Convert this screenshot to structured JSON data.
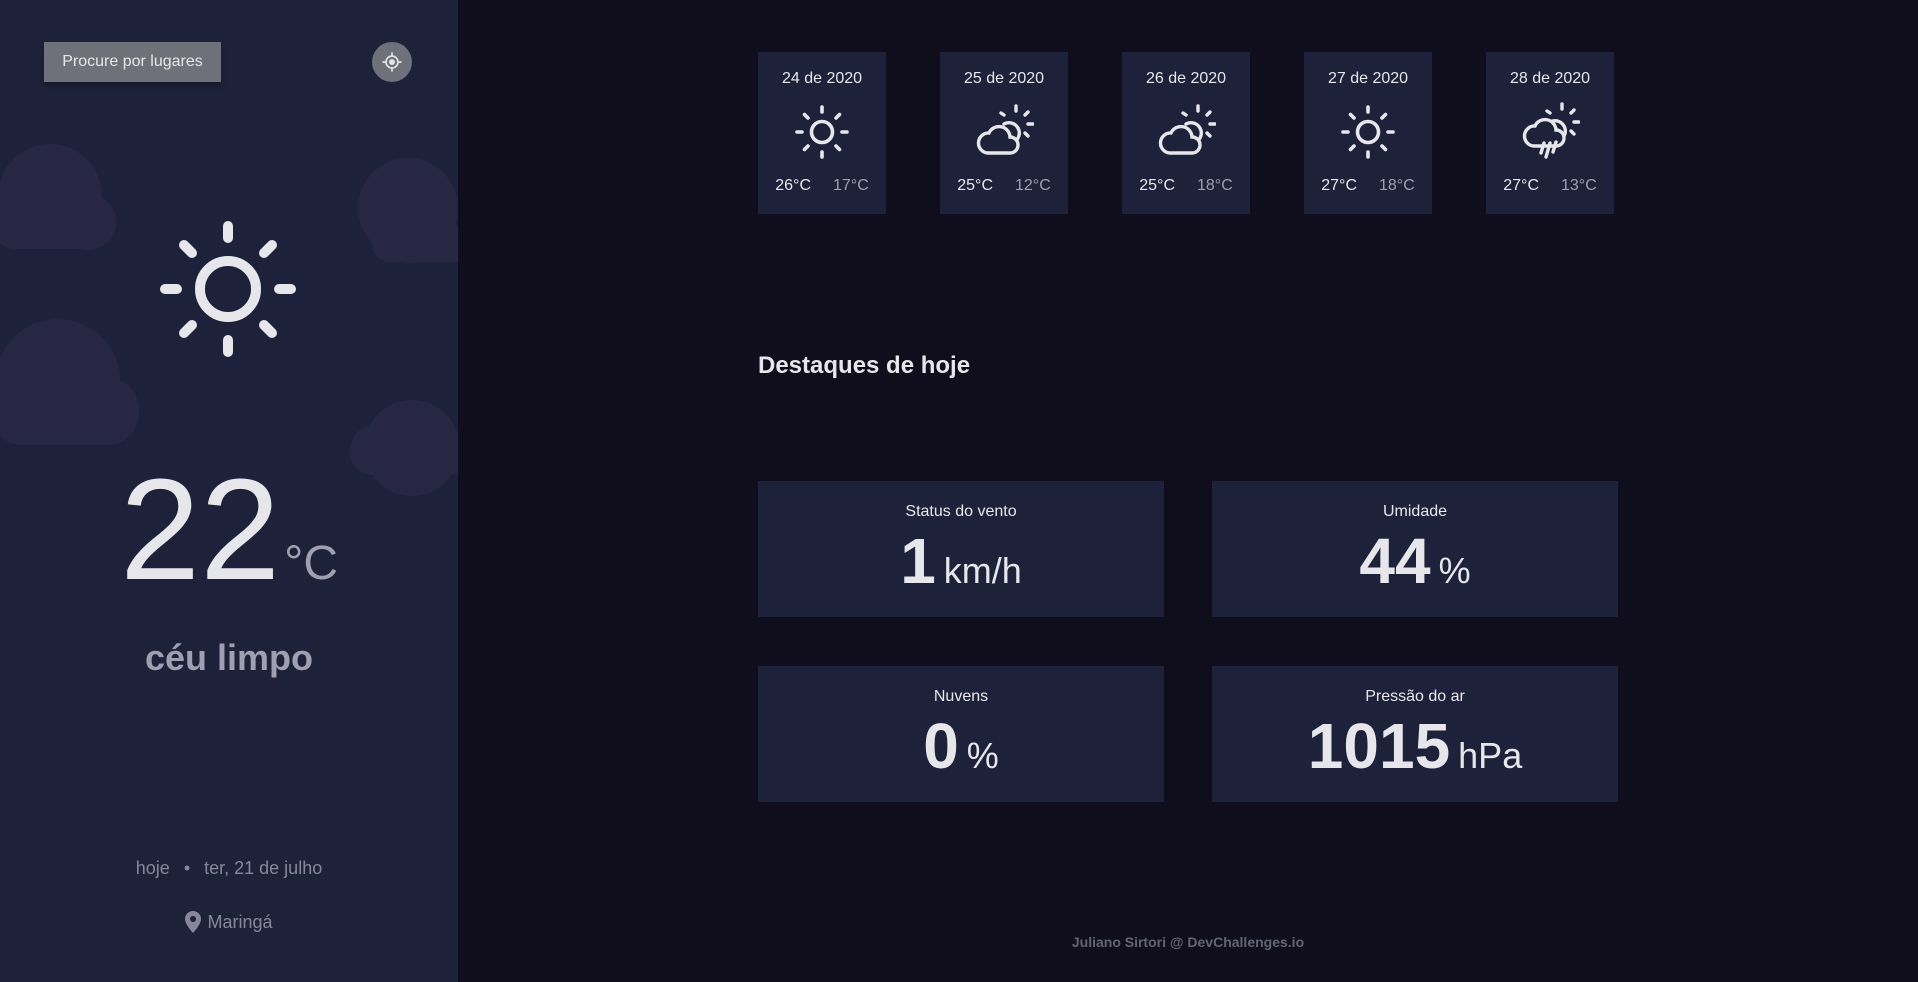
{
  "colors": {
    "background": "#100e1d",
    "panel": "#1e213a",
    "button_gray": "#6e707a",
    "text_primary": "#e7e7eb",
    "text_secondary": "#a09fb1",
    "text_muted": "#88869d"
  },
  "sidebar": {
    "search_label": "Procure por lugares",
    "locate_icon": "crosshair-icon",
    "weather_icon": "sun-icon",
    "temperature": "22",
    "temperature_unit": "°C",
    "condition": "céu limpo",
    "today_label": "hoje",
    "separator": "•",
    "date": "ter, 21 de julho",
    "location_icon": "map-pin-icon",
    "location": "Maringá"
  },
  "forecast": [
    {
      "date": "24 de 2020",
      "icon": "sun-icon",
      "max": "26°C",
      "min": "17°C"
    },
    {
      "date": "25 de 2020",
      "icon": "sun-cloud-icon",
      "max": "25°C",
      "min": "12°C"
    },
    {
      "date": "26 de 2020",
      "icon": "sun-cloud-icon",
      "max": "25°C",
      "min": "18°C"
    },
    {
      "date": "27 de 2020",
      "icon": "sun-icon",
      "max": "27°C",
      "min": "18°C"
    },
    {
      "date": "28 de 2020",
      "icon": "sun-cloud-rain-icon",
      "max": "27°C",
      "min": "13°C"
    }
  ],
  "highlights": {
    "title": "Destaques de hoje",
    "wind": {
      "label": "Status do vento",
      "value": "1",
      "unit": "km/h"
    },
    "humidity": {
      "label": "Umidade",
      "value": "44",
      "unit": "%"
    },
    "clouds": {
      "label": "Nuvens",
      "value": "0",
      "unit": "%"
    },
    "pressure": {
      "label": "Pressão do ar",
      "value": "1015",
      "unit": "hPa"
    }
  },
  "footer": "Juliano Sirtori @ DevChallenges.io"
}
